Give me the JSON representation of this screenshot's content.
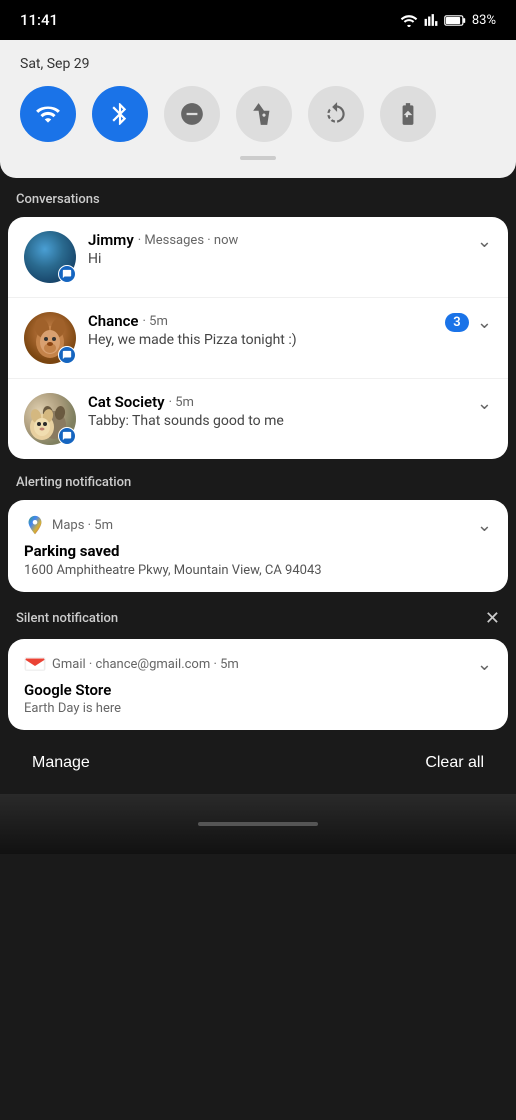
{
  "statusBar": {
    "time": "11:41",
    "battery": "83%"
  },
  "quickSettings": {
    "date": "Sat, Sep 29",
    "toggles": [
      {
        "id": "wifi",
        "label": "Wi-Fi",
        "active": true
      },
      {
        "id": "bluetooth",
        "label": "Bluetooth",
        "active": true
      },
      {
        "id": "dnd",
        "label": "Do Not Disturb",
        "active": false
      },
      {
        "id": "flashlight",
        "label": "Flashlight",
        "active": false
      },
      {
        "id": "rotate",
        "label": "Auto Rotate",
        "active": false
      },
      {
        "id": "battery",
        "label": "Battery Saver",
        "active": false
      }
    ]
  },
  "sections": {
    "conversations": {
      "label": "Conversations",
      "items": [
        {
          "name": "Jimmy",
          "app": "Messages",
          "time": "now",
          "message": "Hi",
          "unread": null
        },
        {
          "name": "Chance",
          "app": "",
          "time": "5m",
          "message": "Hey, we made this Pizza tonight :)",
          "unread": "3"
        },
        {
          "name": "Cat Society",
          "app": "",
          "time": "5m",
          "message": "Tabby: That sounds good to me",
          "unread": null
        }
      ]
    },
    "alerting": {
      "label": "Alerting notification",
      "items": [
        {
          "app": "Maps",
          "time": "5m",
          "title": "Parking saved",
          "body": "1600 Amphitheatre Pkwy, Mountain View, CA 94043"
        }
      ]
    },
    "silent": {
      "label": "Silent notification",
      "items": [
        {
          "app": "Gmail",
          "meta": "chance@gmail.com",
          "time": "5m",
          "title": "Google Store",
          "body": "Earth Day is here"
        }
      ]
    }
  },
  "footer": {
    "manage": "Manage",
    "clearAll": "Clear all"
  }
}
